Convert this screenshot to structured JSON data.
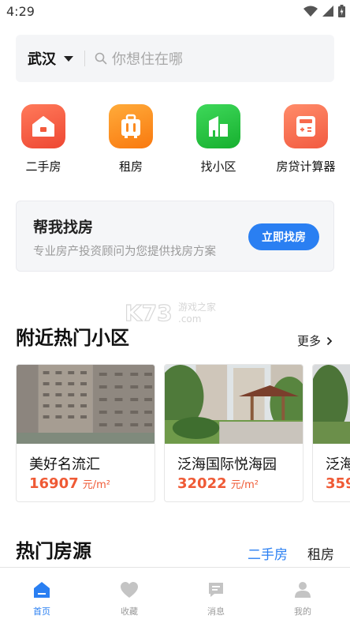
{
  "status_bar": {
    "time": "4:29"
  },
  "search": {
    "city": "武汉",
    "placeholder": "你想住在哪"
  },
  "quick_nav": [
    {
      "label": "二手房",
      "icon": "house-icon",
      "color": "#f25a3c"
    },
    {
      "label": "租房",
      "icon": "suitcase-icon",
      "color": "#fb8a1f"
    },
    {
      "label": "找小区",
      "icon": "buildings-icon",
      "color": "#24c03e"
    },
    {
      "label": "房贷计算器",
      "icon": "calculator-icon",
      "color": "#f76a4d"
    }
  ],
  "help_card": {
    "title": "帮我找房",
    "subtitle": "专业房产投资顾问为您提供找房方案",
    "button": "立即找房"
  },
  "watermark": {
    "text": "K73",
    "sub": "游戏之家",
    "domain": ".com"
  },
  "nearby": {
    "title": "附近热门小区",
    "more": "更多",
    "communities": [
      {
        "name": "美好名流汇",
        "price": "16907",
        "unit": "元/m²"
      },
      {
        "name": "泛海国际悦海园",
        "price": "32022",
        "unit": "元/m²"
      },
      {
        "name": "泛海",
        "price": "359",
        "unit": ""
      }
    ]
  },
  "hot_listings": {
    "title": "热门房源",
    "tabs": [
      "二手房",
      "租房"
    ],
    "active_tab": "二手房"
  },
  "bottom_nav": [
    {
      "label": "首页",
      "icon": "home-icon",
      "active": true
    },
    {
      "label": "收藏",
      "icon": "heart-icon",
      "active": false
    },
    {
      "label": "消息",
      "icon": "message-icon",
      "active": false
    },
    {
      "label": "我的",
      "icon": "user-icon",
      "active": false
    }
  ],
  "colors": {
    "accent": "#2a7ff2",
    "price": "#ef5a35",
    "inactive": "#bfbfbf"
  }
}
